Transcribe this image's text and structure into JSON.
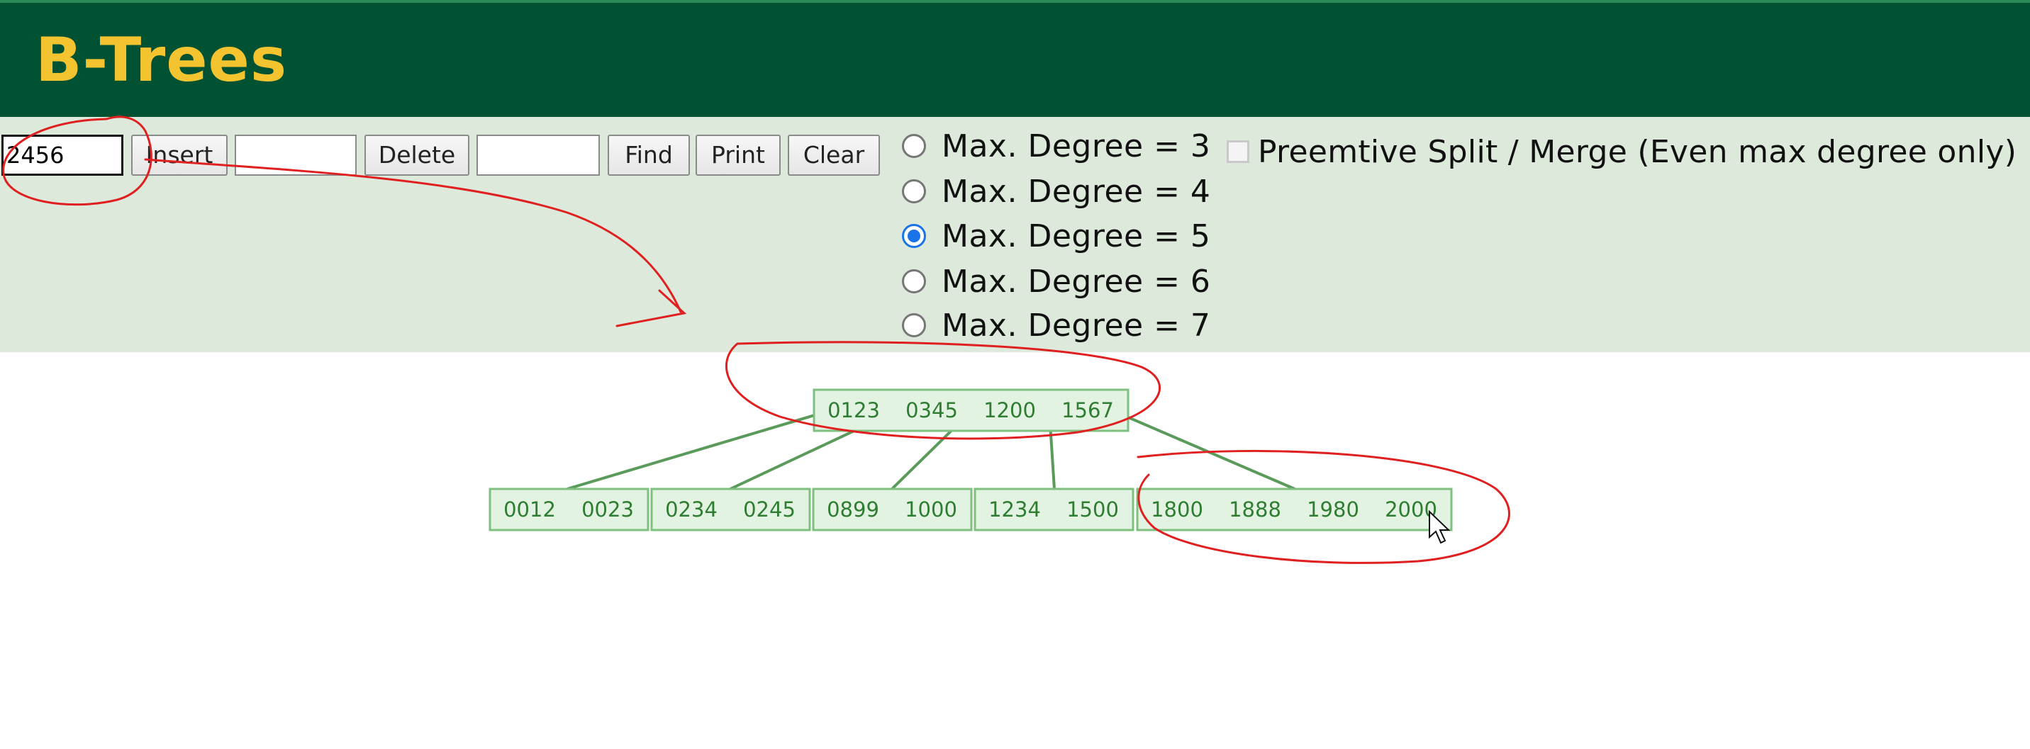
{
  "header": {
    "title": "B-Trees"
  },
  "toolbar": {
    "insert_value": "2456",
    "insert_label": "Insert",
    "delete_value": "",
    "delete_label": "Delete",
    "find_value": "",
    "find_label": "Find",
    "print_label": "Print",
    "clear_label": "Clear"
  },
  "degree_options": [
    {
      "label": "Max. Degree = 3",
      "checked": false
    },
    {
      "label": "Max. Degree = 4",
      "checked": false
    },
    {
      "label": "Max. Degree = 5",
      "checked": true
    },
    {
      "label": "Max. Degree = 6",
      "checked": false
    },
    {
      "label": "Max. Degree = 7",
      "checked": false
    }
  ],
  "preemptive": {
    "label": "Preemtive Split / Merge (Even max degree only)",
    "checked": false
  },
  "tree": {
    "root": [
      "0123",
      "0345",
      "1200",
      "1567"
    ],
    "leaves": [
      [
        "0012",
        "0023"
      ],
      [
        "0234",
        "0245"
      ],
      [
        "0899",
        "1000"
      ],
      [
        "1234",
        "1500"
      ],
      [
        "1800",
        "1888",
        "1980",
        "2000"
      ]
    ]
  },
  "colors": {
    "header_bg": "#005232",
    "title": "#f4c430",
    "controls_bg": "#dde9db",
    "node_fill": "#e3f3e1",
    "node_stroke": "#7fbf7f",
    "edge": "#5a9a5a",
    "annotation": "#e02020"
  }
}
